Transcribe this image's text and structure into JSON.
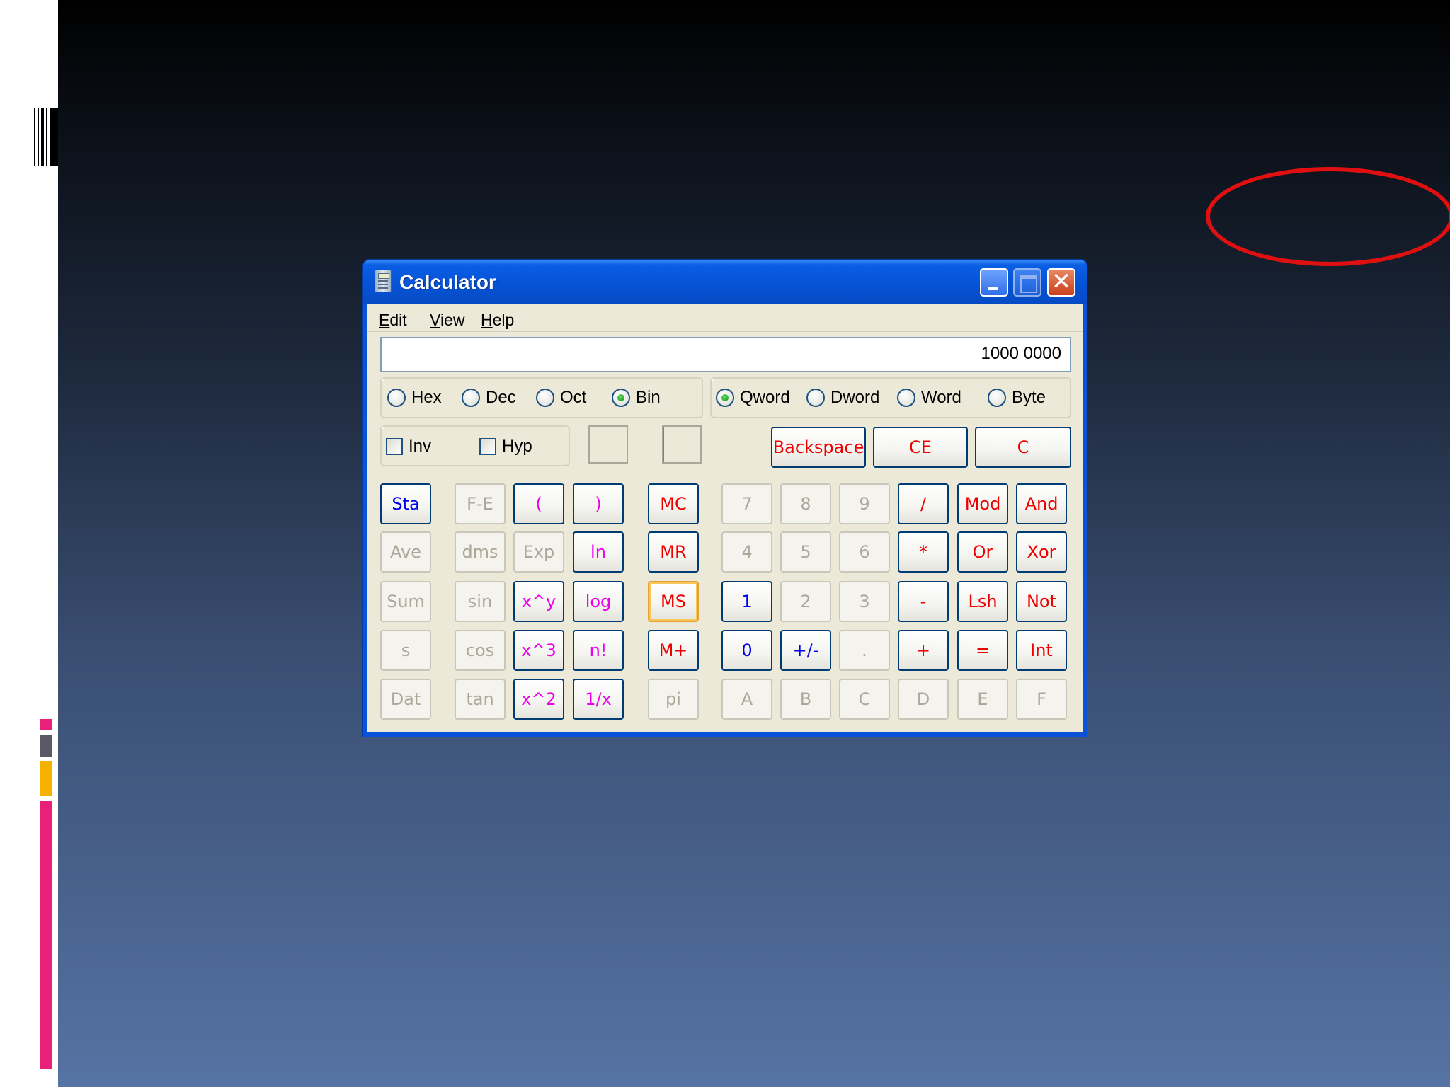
{
  "window": {
    "title": "Calculator",
    "close_glyph": "✕"
  },
  "menu": {
    "items": [
      {
        "accel": "E",
        "rest": "dit"
      },
      {
        "accel": "V",
        "rest": "iew"
      },
      {
        "accel": "H",
        "rest": "elp"
      }
    ]
  },
  "display": {
    "value": "1000 0000"
  },
  "base_modes": [
    {
      "label": "Hex",
      "selected": false
    },
    {
      "label": "Dec",
      "selected": false
    },
    {
      "label": "Oct",
      "selected": false
    },
    {
      "label": "Bin",
      "selected": true
    }
  ],
  "word_sizes": [
    {
      "label": "Qword",
      "selected": true
    },
    {
      "label": "Dword",
      "selected": false
    },
    {
      "label": "Word",
      "selected": false
    },
    {
      "label": "Byte",
      "selected": false
    }
  ],
  "checks": [
    {
      "label": "Inv",
      "checked": false
    },
    {
      "label": "Hyp",
      "checked": false
    }
  ],
  "edit_buttons": [
    "Backspace",
    "CE",
    "C"
  ],
  "buttons": {
    "stat": [
      "Sta",
      "Ave",
      "Sum",
      "s",
      "Dat"
    ],
    "sci1": [
      "F-E",
      "dms",
      "sin",
      "cos",
      "tan"
    ],
    "sci2": [
      "(",
      "Exp",
      "x^y",
      "x^3",
      "x^2"
    ],
    "sci3": [
      ")",
      "ln",
      "log",
      "n!",
      "1/x"
    ],
    "memory": [
      "MC",
      "MR",
      "MS",
      "M+",
      "pi"
    ],
    "numpad": [
      [
        "7",
        "8",
        "9",
        "/",
        "Mod",
        "And"
      ],
      [
        "4",
        "5",
        "6",
        "*",
        "Or",
        "Xor"
      ],
      [
        "1",
        "2",
        "3",
        "-",
        "Lsh",
        "Not"
      ],
      [
        "0",
        "+/-",
        ".",
        "+",
        "=",
        "Int"
      ],
      [
        "A",
        "B",
        "C",
        "D",
        "E",
        "F"
      ]
    ]
  },
  "colors": {
    "accent_red": "#e01010",
    "titlebar_blue": "#0754d8",
    "label_blue": "#0000ee",
    "label_red": "#ee0000",
    "label_magenta": "#ee00ee",
    "disabled_gray": "#aca899"
  }
}
